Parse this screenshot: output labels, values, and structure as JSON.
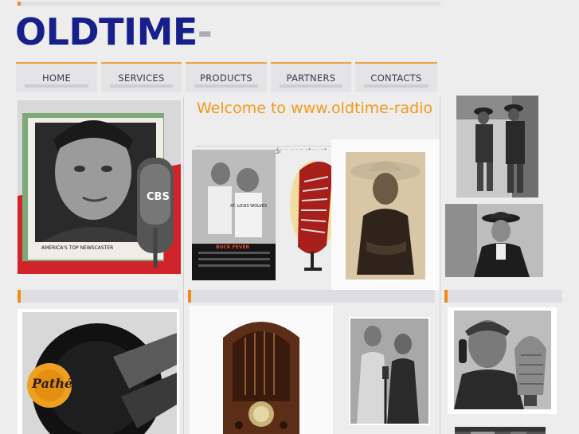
{
  "site": {
    "logo_text": "OLDTIME",
    "logo_dash": "-"
  },
  "nav": [
    {
      "label": "HOME"
    },
    {
      "label": "SERVICES"
    },
    {
      "label": "PRODUCTS"
    },
    {
      "label": "PARTNERS"
    },
    {
      "label": "CONTACTS"
    }
  ],
  "main": {
    "welcome_title": "Welcome to www.oldtime-radio",
    "construction_note": "der construct"
  },
  "photos": {
    "newscaster_caption": "AMERICA'S TOP NEWSCASTER",
    "mic_logo": "CBS",
    "team_jersey_text": "ST. LOUIS WOLVES",
    "poster_title": "BUCK FEVER",
    "record_label": "Pathé"
  },
  "colors": {
    "logo": "#17208a",
    "accent_orange": "#f08a1c",
    "welcome_text": "#f29a1a",
    "background": "#eeedee"
  }
}
